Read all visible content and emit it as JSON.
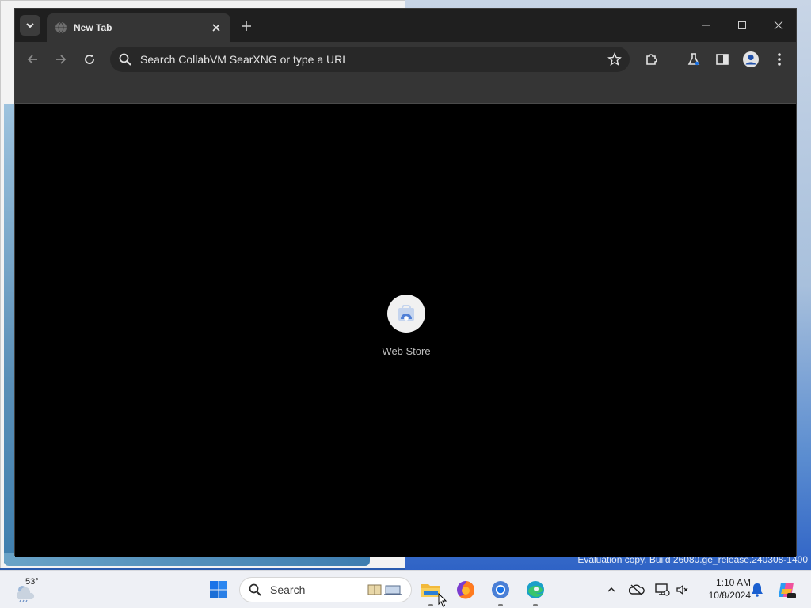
{
  "browser": {
    "tab": {
      "title": "New Tab"
    },
    "omnibox": {
      "placeholder": "Search CollabVM SearXNG or type a URL"
    },
    "shortcuts": [
      {
        "label": "Web Store"
      }
    ]
  },
  "desktop": {
    "watermark": "Evaluation copy. Build 26080.ge_release.240308-1400"
  },
  "taskbar": {
    "weather": {
      "temp": "53°"
    },
    "search": {
      "placeholder": "Search"
    },
    "clock": {
      "time": "1:10 AM",
      "date": "10/8/2024"
    }
  },
  "icons": {
    "tab_search": "chevron-down-icon",
    "globe": "globe-icon",
    "close_tab": "close-icon",
    "new_tab": "plus-icon",
    "back": "back-arrow-icon",
    "forward": "forward-arrow-icon",
    "reload": "reload-icon",
    "bookmark": "star-icon",
    "extensions": "puzzle-icon",
    "labs": "flask-icon",
    "side_panel": "side-panel-icon",
    "profile": "profile-icon",
    "menu": "kebab-menu-icon"
  },
  "colors": {
    "browser_frame": "#1f1f1f",
    "toolbar": "#353535",
    "content_bg": "#000000",
    "taskbar": "#eef0f5",
    "accent": "#1a73e8"
  }
}
